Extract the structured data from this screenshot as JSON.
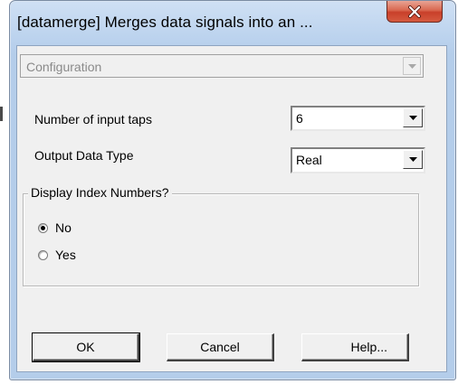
{
  "window": {
    "title": "[datamerge] Merges data signals into an ..."
  },
  "configuration": {
    "label": "Configuration"
  },
  "fields": {
    "input_taps_label": "Number of input taps",
    "input_taps_value": "6",
    "output_type_label": "Output Data Type",
    "output_type_value": "Real"
  },
  "display_index": {
    "title": "Display Index Numbers?",
    "options": [
      {
        "label": "No",
        "selected": true
      },
      {
        "label": "Yes",
        "selected": false
      }
    ]
  },
  "buttons": {
    "ok": "OK",
    "cancel": "Cancel",
    "help": "Help..."
  },
  "icons": {
    "close": "close-icon",
    "dropdown": "chevron-down-icon"
  },
  "colors": {
    "close_button": "#c9402a",
    "title_bar": "#bcd3ee",
    "client_bg": "#f0f0f0"
  }
}
